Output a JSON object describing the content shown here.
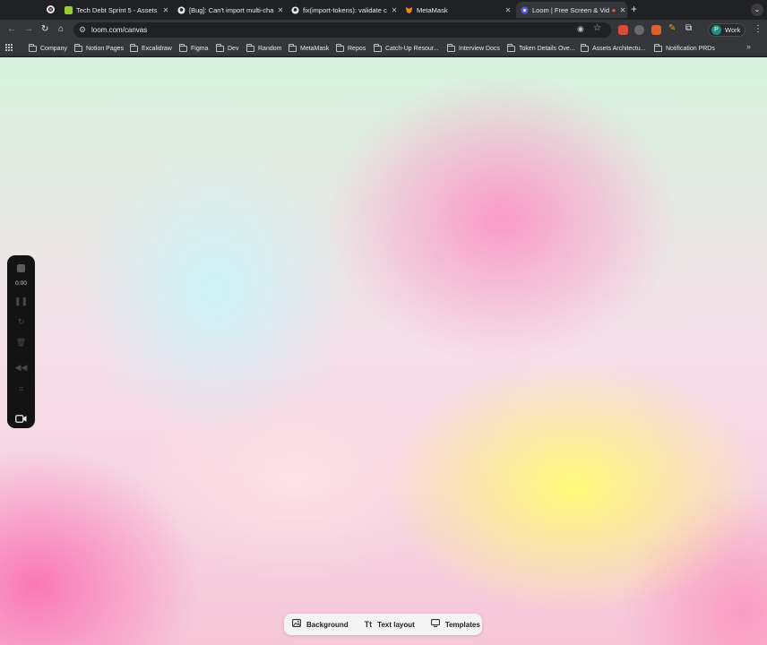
{
  "tabs": [
    {
      "title": "Tech Debt Sprint 5 - Assets",
      "favicon": "notion-style-icon",
      "color": "#9acd32",
      "active": false
    },
    {
      "title": "[Bug]: Can't import multi-cha",
      "favicon": "github-icon",
      "color": "#ffffff",
      "active": false
    },
    {
      "title": "fix(import-tokens): validate c",
      "favicon": "github-icon",
      "color": "#ffffff",
      "active": false
    },
    {
      "title": "MetaMask",
      "favicon": "metamask-fox-icon",
      "color": "#f6851b",
      "active": false
    },
    {
      "title": "Loom | Free Screen & Vide",
      "favicon": "loom-icon",
      "color": "#565add",
      "active": true
    }
  ],
  "toolbar": {
    "url": "loom.com/canvas",
    "profile_initial": "P",
    "profile_label": "Work"
  },
  "bookmarks": [
    "Company",
    "Notion Pages",
    "Excalidraw",
    "Figma",
    "Dev",
    "Random",
    "MetaMask",
    "Repos",
    "Catch-Up Resour...",
    "Interview Docs",
    "Token Details Ove...",
    "Assets Architectu...",
    "Notification PRDs"
  ],
  "recorder": {
    "timer": "0:00"
  },
  "canvas_toolbar": {
    "background_label": "Background",
    "text_layout_label": "Text layout",
    "templates_label": "Templates"
  },
  "colors": {
    "accent": "#565add",
    "chrome_dark": "#202124",
    "chrome_toolbar": "#35363a"
  }
}
